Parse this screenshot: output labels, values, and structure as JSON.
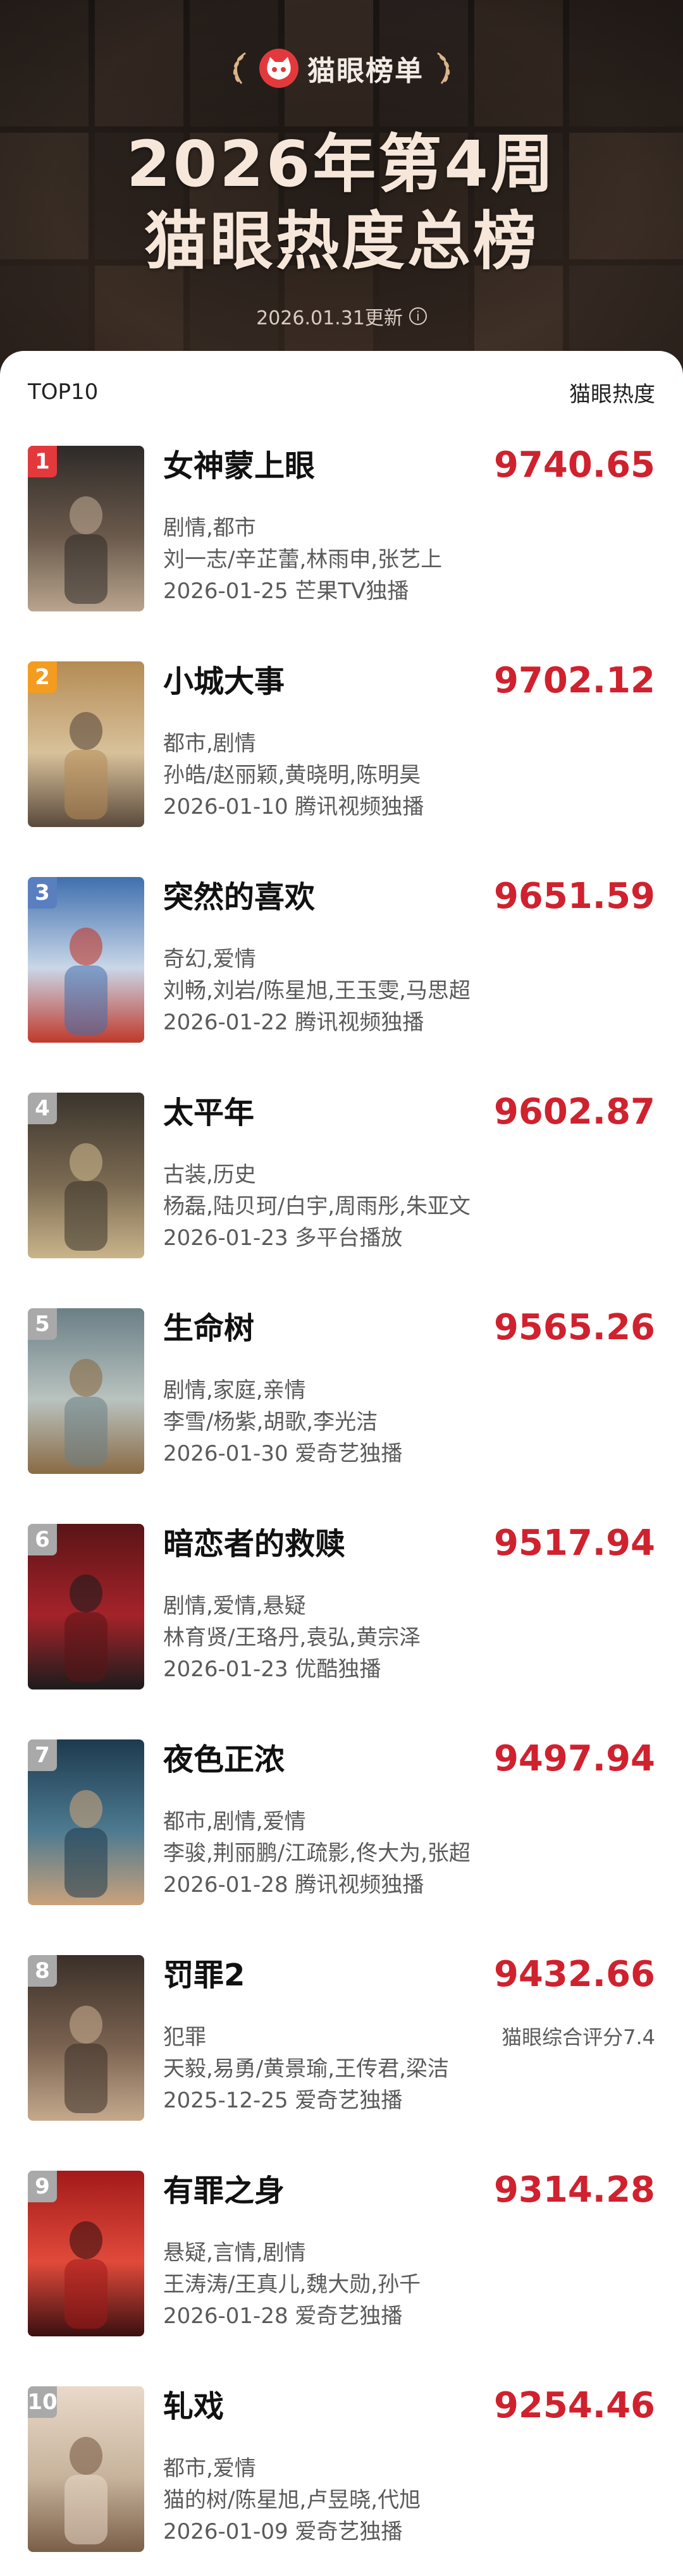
{
  "header": {
    "brand": "猫眼榜单",
    "title_line1": "2026年第4周",
    "title_line2": "猫眼热度总榜",
    "update_text": "2026.01.31更新",
    "logo_color": "#e4393c"
  },
  "list": {
    "left_label": "TOP10",
    "right_label": "猫眼热度",
    "score_color": "#d0212e",
    "items": [
      {
        "rank": "1",
        "title": "女神蒙上眼",
        "score": "9740.65",
        "genre": "剧情,都市",
        "cast": "刘一志/辛芷蕾,林雨申,张艺上",
        "release": "2026-01-25  芒果TV独播",
        "badge_color": "#e4393c",
        "poster_colors": [
          "#2e2a28",
          "#6b5a4c",
          "#b9a58e"
        ]
      },
      {
        "rank": "2",
        "title": "小城大事",
        "score": "9702.12",
        "genre": "都市,剧情",
        "cast": "孙皓/赵丽颖,黄晓明,陈明昊",
        "release": "2026-01-10  腾讯视频独播",
        "badge_color": "#f39c1f",
        "poster_colors": [
          "#b48b55",
          "#d8c19a",
          "#5a4a3c"
        ]
      },
      {
        "rank": "3",
        "title": "突然的喜欢",
        "score": "9651.59",
        "genre": "奇幻,爱情",
        "cast": "刘畅,刘岩/陈星旭,王玉雯,马思超",
        "release": "2026-01-22  腾讯视频独播",
        "badge_color": "#5a7fc0",
        "poster_colors": [
          "#3f6fae",
          "#c9d7e8",
          "#c0392b"
        ]
      },
      {
        "rank": "4",
        "title": "太平年",
        "score": "9602.87",
        "genre": "古装,历史",
        "cast": "杨磊,陆贝珂/白宇,周雨彤,朱亚文",
        "release": "2026-01-23  多平台播放",
        "badge_color": "#a9a9a9",
        "poster_colors": [
          "#3a342c",
          "#7b6a52",
          "#c9b48a"
        ]
      },
      {
        "rank": "5",
        "title": "生命树",
        "score": "9565.26",
        "genre": "剧情,家庭,亲情",
        "cast": "李雪/杨紫,胡歌,李光洁",
        "release": "2026-01-30  爱奇艺独播",
        "badge_color": "#a9a9a9",
        "poster_colors": [
          "#6a7f86",
          "#b9c3bf",
          "#8a6a44"
        ]
      },
      {
        "rank": "6",
        "title": "暗恋者的救赎",
        "score": "9517.94",
        "genre": "剧情,爱情,悬疑",
        "cast": "林育贤/王珞丹,袁弘,黄宗泽",
        "release": "2026-01-23  优酷独播",
        "badge_color": "#a9a9a9",
        "poster_colors": [
          "#5a1416",
          "#a4232a",
          "#1c1c1c"
        ]
      },
      {
        "rank": "7",
        "title": "夜色正浓",
        "score": "9497.94",
        "genre": "都市,剧情,爱情",
        "cast": "李骏,荆丽鹏/江疏影,佟大为,张超",
        "release": "2026-01-28  腾讯视频独播",
        "badge_color": "#a9a9a9",
        "poster_colors": [
          "#1d3a4e",
          "#4d7a90",
          "#c9a27a"
        ]
      },
      {
        "rank": "8",
        "title": "罚罪2",
        "score": "9432.66",
        "genre": "犯罪",
        "cast": "天毅,易勇/黄景瑜,王传君,梁洁",
        "release": "2025-12-25  爱奇艺独播",
        "badge_color": "#a9a9a9",
        "poster_colors": [
          "#3a2f28",
          "#7a6250",
          "#c4a98c"
        ],
        "sub_score": "猫眼综合评分7.4"
      },
      {
        "rank": "9",
        "title": "有罪之身",
        "score": "9314.28",
        "genre": "悬疑,言情,剧情",
        "cast": "王涛涛/王真儿,魏大勋,孙千",
        "release": "2026-01-28  爱奇艺独播",
        "badge_color": "#a9a9a9",
        "poster_colors": [
          "#a31a1a",
          "#e04a3a",
          "#3a1010"
        ]
      },
      {
        "rank": "10",
        "title": "轧戏",
        "score": "9254.46",
        "genre": "都市,爱情",
        "cast": "猫的树/陈星旭,卢昱晓,代旭",
        "release": "2026-01-09  爱奇艺独播",
        "badge_color": "#a9a9a9",
        "poster_colors": [
          "#e9d9c9",
          "#c7b39c",
          "#7a5e48"
        ]
      }
    ]
  }
}
